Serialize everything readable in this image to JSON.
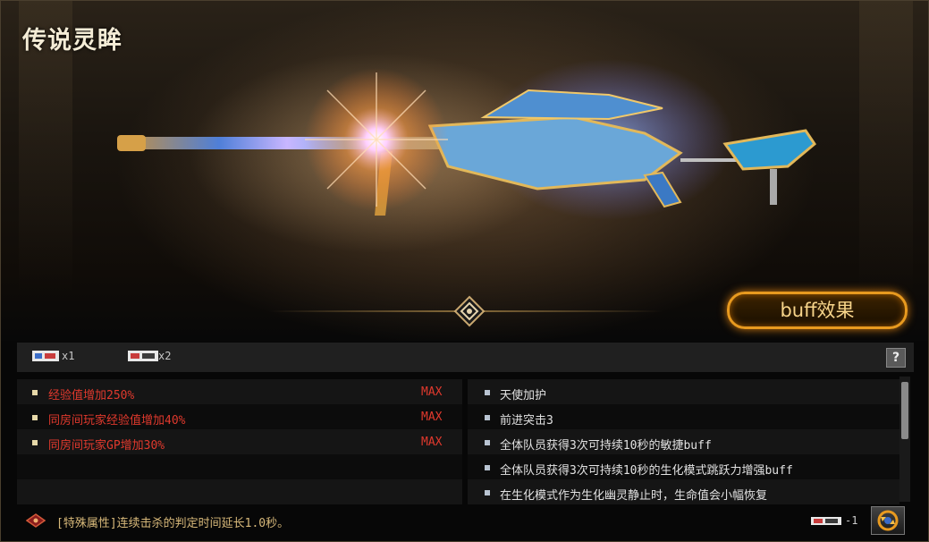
{
  "weapon_title": "传说灵眸",
  "buff_button_label": "buff效果",
  "materials": [
    {
      "count_label": "x1"
    },
    {
      "count_label": "x2"
    }
  ],
  "help_label": "?",
  "attributes": [
    {
      "text": "经验值增加250%",
      "level": "MAX"
    },
    {
      "text": "同房间玩家经验值增加40%",
      "level": "MAX"
    },
    {
      "text": "同房间玩家GP增加30%",
      "level": "MAX"
    }
  ],
  "buffs": [
    {
      "text": "天使加护"
    },
    {
      "text": "前进突击3"
    },
    {
      "text": "全体队员获得3次可持续10秒的敏捷buff"
    },
    {
      "text": "全体队员获得3次可持续10秒的生化模式跳跃力增强buff"
    },
    {
      "text": "在生化模式作为生化幽灵静止时，生命值会小幅恢复"
    }
  ],
  "special_property": "[特殊属性]连续击杀的判定时间延长1.0秒。",
  "cost_label": "-1",
  "colors": {
    "attribute_red": "#e0392d",
    "buff_text": "#e2e2e2",
    "accent_orange": "#e89a1f",
    "title": "#f4ecd6"
  }
}
